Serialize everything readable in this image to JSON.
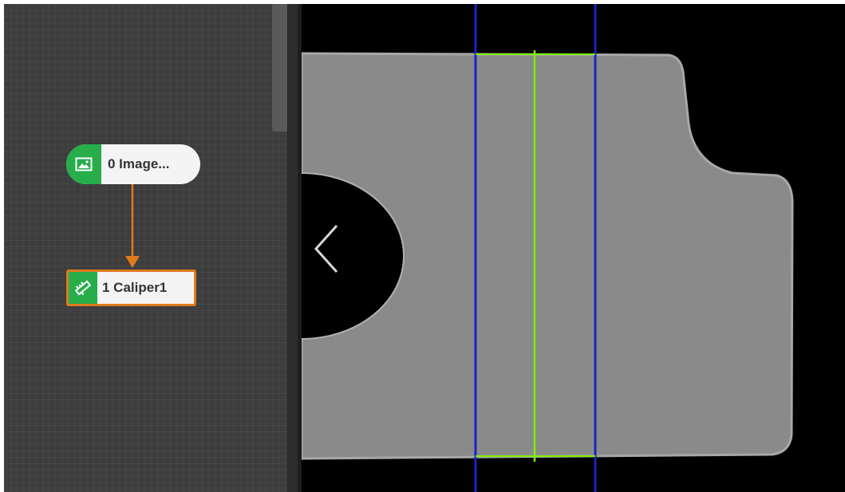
{
  "flow": {
    "nodes": [
      {
        "label": "0 Image...",
        "icon": "image-icon",
        "color": "#27ad4a"
      },
      {
        "label": "1 Caliper1",
        "icon": "caliper-icon",
        "color": "#27ad4a",
        "border_color": "#e07a1f"
      }
    ],
    "connector_color": "#e07a1f"
  },
  "viewer": {
    "nav_icon": "chevron-left-icon",
    "part_color": "#8a8a8a",
    "search_region_color": "#1a22c8",
    "edge_line_color": "#7cf000"
  }
}
